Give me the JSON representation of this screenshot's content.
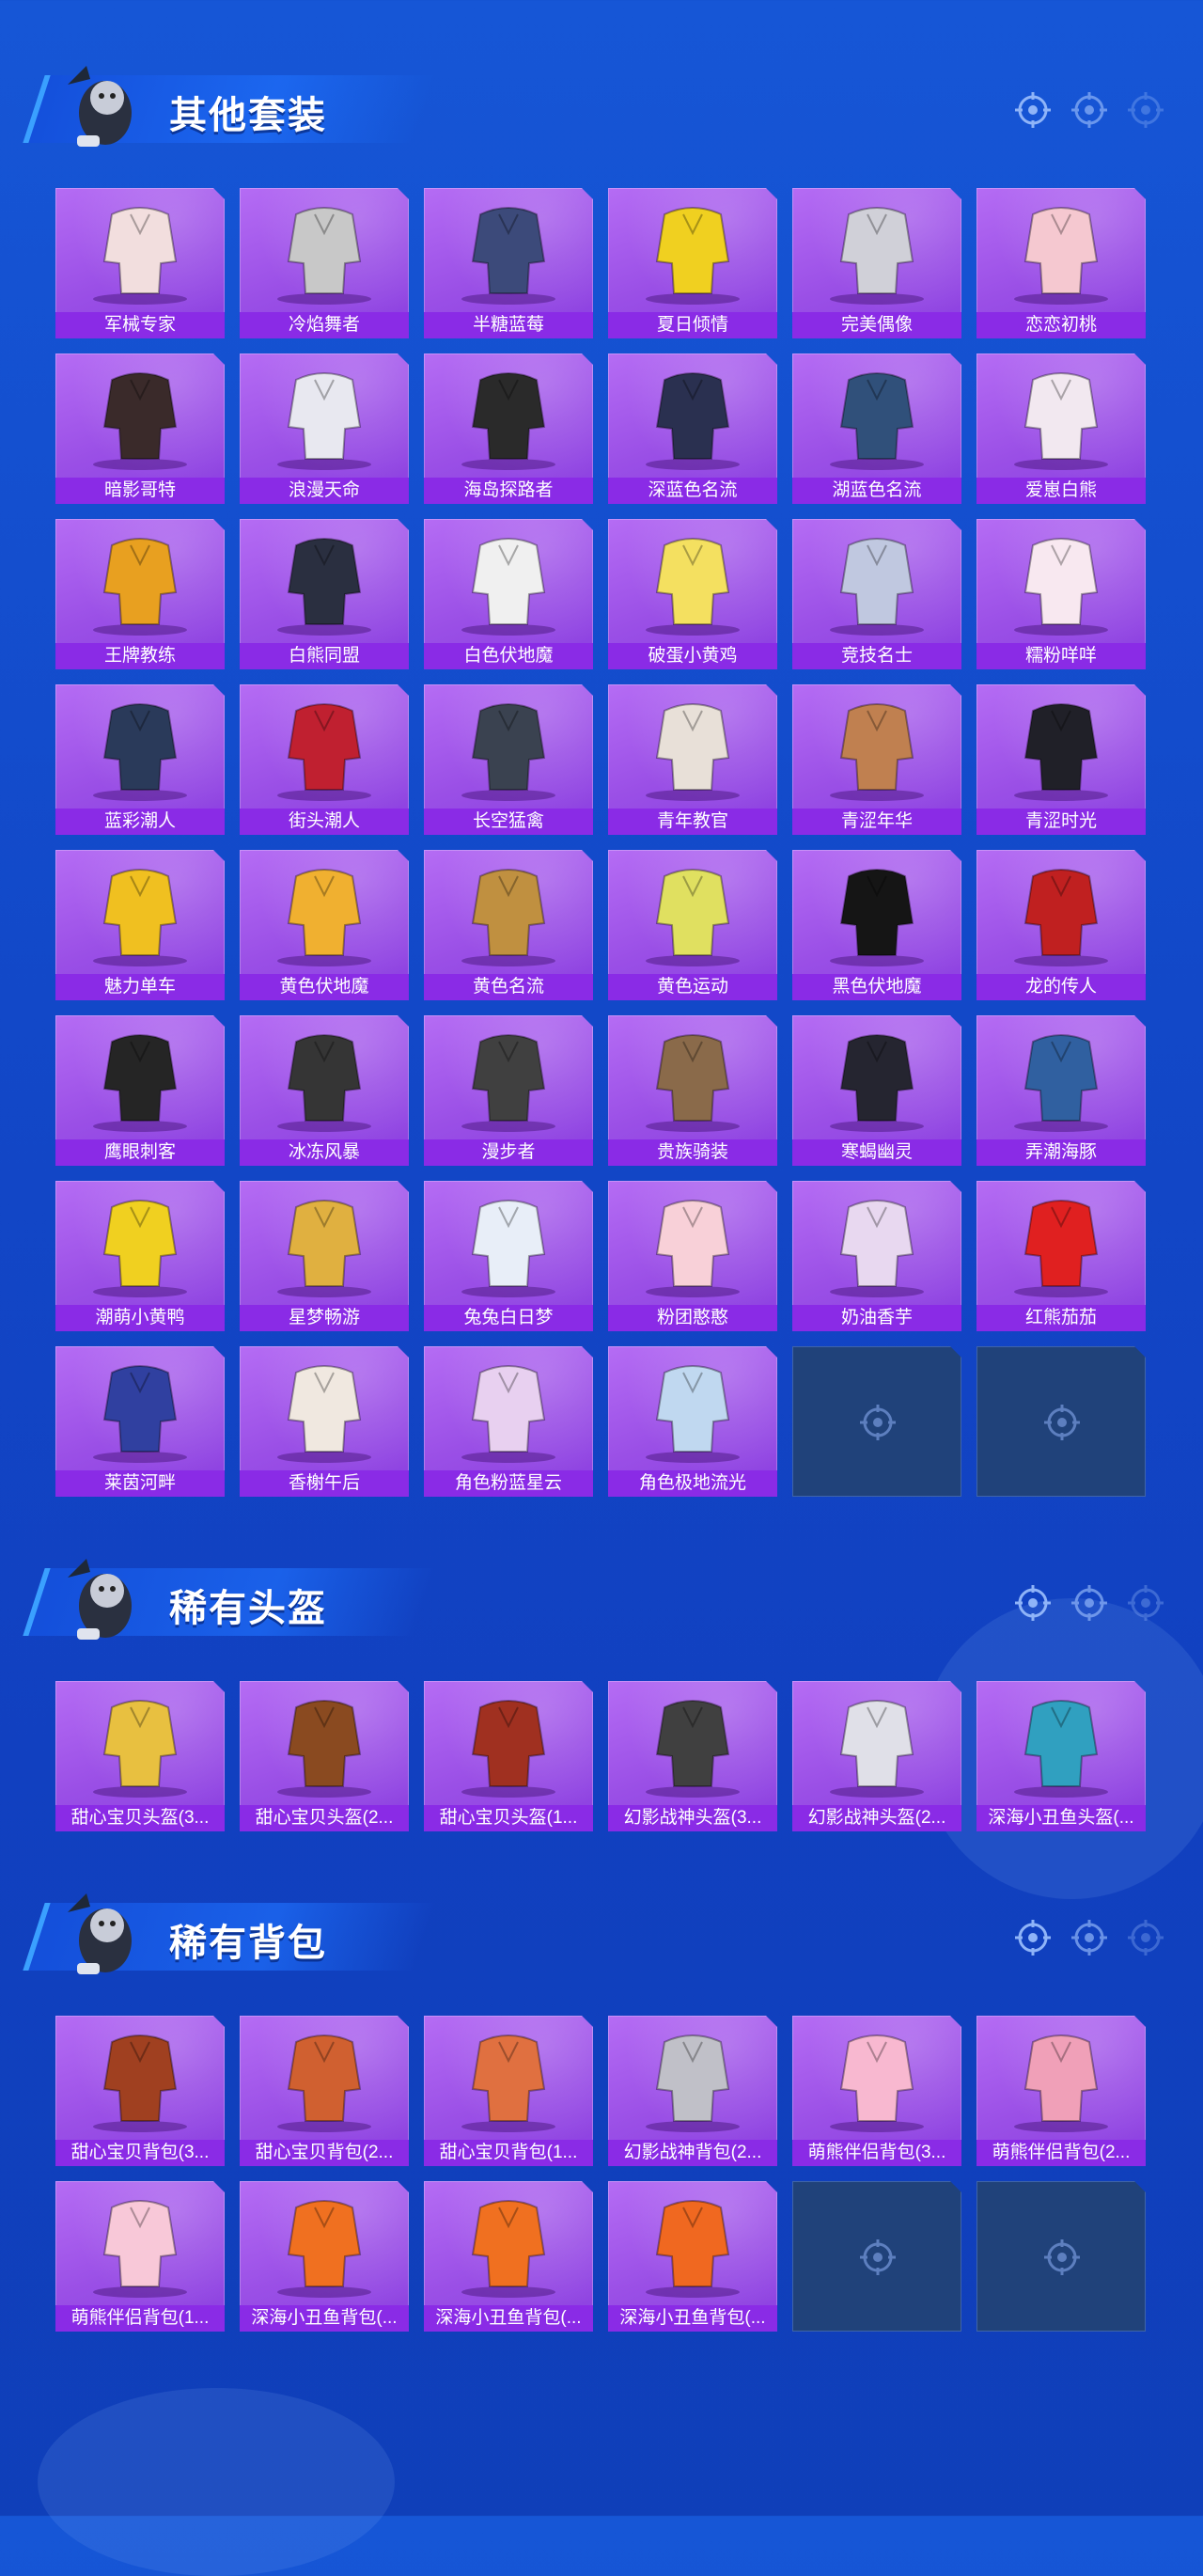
{
  "sections": [
    {
      "title": "其他套装",
      "items": [
        "军械专家",
        "冷焰舞者",
        "半糖蓝莓",
        "夏日倾情",
        "完美偶像",
        "恋恋初桃",
        "暗影哥特",
        "浪漫天命",
        "海岛探路者",
        "深蓝色名流",
        "湖蓝色名流",
        "爱崽白熊",
        "王牌教练",
        "白熊同盟",
        "白色伏地魔",
        "破蛋小黄鸡",
        "竞技名士",
        "糯粉咩咩",
        "蓝彩潮人",
        "街头潮人",
        "长空猛禽",
        "青年教官",
        "青涩年华",
        "青涩时光",
        "魅力单车",
        "黄色伏地魔",
        "黄色名流",
        "黄色运动",
        "黑色伏地魔",
        "龙的传人",
        "鹰眼刺客",
        "冰冻风暴",
        "漫步者",
        "贵族骑装",
        "寒蝎幽灵",
        "弄潮海豚",
        "潮萌小黄鸭",
        "星梦畅游",
        "兔兔白日梦",
        "粉团憨憨",
        "奶油香芋",
        "红熊茄茄",
        "莱茵河畔",
        "香榭午后",
        "角色粉蓝星云",
        "角色极地流光"
      ],
      "empty_slots": 2,
      "art_colors": [
        "#f2dede",
        "#c8c8c8",
        "#3c4a7a",
        "#f0d020",
        "#d0d0d8",
        "#f5c8d0",
        "#3a2a2a",
        "#e8e8f0",
        "#2a2a2a",
        "#2a3050",
        "#30507a",
        "#f2e8f0",
        "#e8a020",
        "#2a2f40",
        "#f0f0f0",
        "#f4e060",
        "#c0c8e0",
        "#f8e8f0",
        "#2a3a5a",
        "#c02030",
        "#3a4250",
        "#e8e0d8",
        "#c08050",
        "#202028",
        "#f0c020",
        "#f0b030",
        "#c09040",
        "#e0e060",
        "#151515",
        "#c02020",
        "#252525",
        "#353535",
        "#404040",
        "#8a6a4a",
        "#252530",
        "#3060a0",
        "#f0d020",
        "#e0b040",
        "#e8eef8",
        "#f8d0d8",
        "#e8d8f0",
        "#e02020",
        "#3040a0",
        "#f0e8e0",
        "#e8d0f0",
        "#c0d8f0"
      ]
    },
    {
      "title": "稀有头盔",
      "items": [
        "甜心宝贝头盔(3...",
        "甜心宝贝头盔(2...",
        "甜心宝贝头盔(1...",
        "幻影战神头盔(3...",
        "幻影战神头盔(2...",
        "深海小丑鱼头盔(..."
      ],
      "empty_slots": 0,
      "art_colors": [
        "#e8c040",
        "#8a4a20",
        "#a03020",
        "#404040",
        "#e0e0e8",
        "#30a0c0"
      ]
    },
    {
      "title": "稀有背包",
      "items": [
        "甜心宝贝背包(3...",
        "甜心宝贝背包(2...",
        "甜心宝贝背包(1...",
        "幻影战神背包(2...",
        "萌熊伴侣背包(3...",
        "萌熊伴侣背包(2...",
        "萌熊伴侣背包(1...",
        "深海小丑鱼背包(...",
        "深海小丑鱼背包(...",
        "深海小丑鱼背包(..."
      ],
      "empty_slots": 2,
      "art_colors": [
        "#a04020",
        "#d06030",
        "#e07040",
        "#c0c0c8",
        "#f8b8d0",
        "#f0a0b8",
        "#f8c8d8",
        "#f07020",
        "#f07020",
        "#f06820"
      ]
    }
  ]
}
